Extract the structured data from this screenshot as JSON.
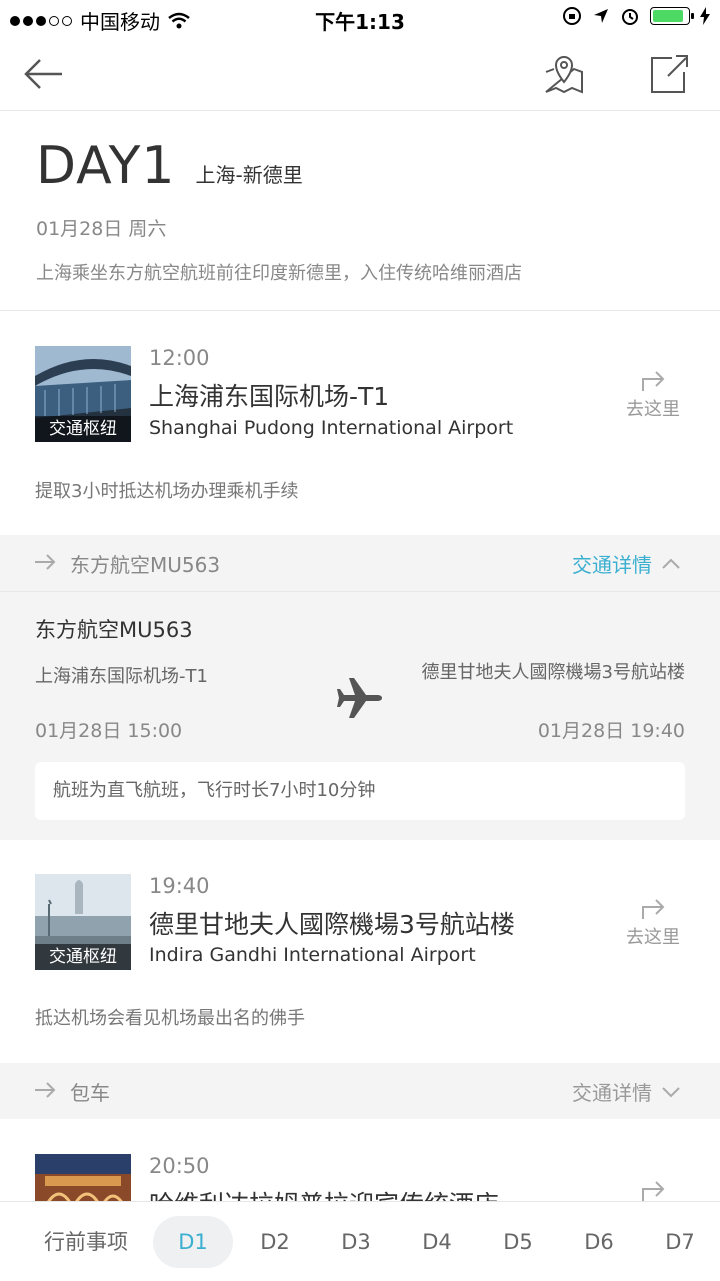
{
  "status_bar": {
    "carrier": "中国移动",
    "time": "下午1:13"
  },
  "day": {
    "title": "DAY1",
    "route": "上海-新德里",
    "date": "01月28日 周六",
    "description": "上海乘坐东方航空航班前往印度新德里，入住传统哈维丽酒店"
  },
  "poi1": {
    "category": "交通枢纽",
    "time": "12:00",
    "name": "上海浦东国际机场-T1",
    "name_en": "Shanghai Pudong International Airport",
    "goto_label": "去这里",
    "note": "提取3小时抵达机场办理乘机手续"
  },
  "transport1": {
    "name": "东方航空MU563",
    "detail_label": "交通详情",
    "expanded": true
  },
  "flight": {
    "name": "东方航空MU563",
    "from": "上海浦东国际机场-T1",
    "to": "德里甘地夫人國際機場3号航站楼",
    "depart": "01月28日 15:00",
    "arrive": "01月28日 19:40",
    "note": "航班为直飞航班，飞行时长7小时10分钟"
  },
  "poi2": {
    "category": "交通枢纽",
    "time": "19:40",
    "name": "德里甘地夫人國際機場3号航站楼",
    "name_en": "Indira Gandhi International Airport",
    "goto_label": "去这里",
    "note": "抵达机场会看见机场最出名的佛手"
  },
  "transport2": {
    "name": "包车",
    "detail_label": "交通详情",
    "expanded": false
  },
  "poi3": {
    "time": "20:50",
    "name": "哈维利达拉姆普拉迎宾传统酒店"
  },
  "tabs": [
    "行前事项",
    "D1",
    "D2",
    "D3",
    "D4",
    "D5",
    "D6",
    "D7"
  ],
  "active_tab": "D1",
  "colors": {
    "accent": "#3aafd0",
    "text": "#333333",
    "muted": "#888888",
    "band": "#f4f4f4"
  }
}
